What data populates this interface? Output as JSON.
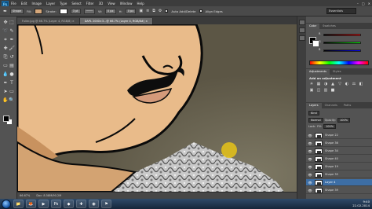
{
  "app": {
    "logo": "Ps"
  },
  "menu": [
    "File",
    "Edit",
    "Image",
    "Layer",
    "Type",
    "Select",
    "Filter",
    "3D",
    "View",
    "Window",
    "Help"
  ],
  "window_controls": [
    "–",
    "□",
    "✕"
  ],
  "options_bar": {
    "tool_mode": "Shape",
    "fill_label": "Fill:",
    "stroke_label": "Stroke:",
    "stroke_width": "3 pt",
    "w_label": "W:",
    "w_value": "0 px",
    "h_label": "H:",
    "h_value": "0 px",
    "auto_add_delete": "Auto Add/Delete",
    "align_edges": "Align Edges",
    "workspace": "Essentials",
    "fill_color": "#d6a77a",
    "stroke_color": "#ffffff"
  },
  "document_tabs": [
    {
      "label": "Fuller.jpg @ 66.7% (Layer 4, RGB/8) ×",
      "active": false
    },
    {
      "label": "DAPL 2000×3...@ 66.7% (Layer 4, RGB/8#) ×",
      "active": true
    }
  ],
  "tools": [
    {
      "name": "move-tool-icon",
      "glyph": "✥"
    },
    {
      "name": "marquee-tool-icon",
      "glyph": "⬚"
    },
    {
      "name": "lasso-tool-icon",
      "glyph": "➰"
    },
    {
      "name": "quick-select-tool-icon",
      "glyph": "✎"
    },
    {
      "name": "crop-tool-icon",
      "glyph": "⌗"
    },
    {
      "name": "eyedropper-tool-icon",
      "glyph": "✒"
    },
    {
      "name": "healing-brush-tool-icon",
      "glyph": "✚"
    },
    {
      "name": "brush-tool-icon",
      "glyph": "🖌"
    },
    {
      "name": "clone-stamp-tool-icon",
      "glyph": "⎘"
    },
    {
      "name": "history-brush-tool-icon",
      "glyph": "↺"
    },
    {
      "name": "eraser-tool-icon",
      "glyph": "▭"
    },
    {
      "name": "gradient-tool-icon",
      "glyph": "▤"
    },
    {
      "name": "blur-tool-icon",
      "glyph": "💧"
    },
    {
      "name": "dodge-tool-icon",
      "glyph": "●"
    },
    {
      "name": "pen-tool-icon",
      "glyph": "✒"
    },
    {
      "name": "type-tool-icon",
      "glyph": "T"
    },
    {
      "name": "path-select-tool-icon",
      "glyph": "➤"
    },
    {
      "name": "shape-tool-icon",
      "glyph": "▭"
    },
    {
      "name": "hand-tool-icon",
      "glyph": "✋"
    },
    {
      "name": "zoom-tool-icon",
      "glyph": "🔍"
    }
  ],
  "status_bar": {
    "zoom": "66.67%",
    "doc_info": "Doc: 8.58M/90.2M"
  },
  "color_panel": {
    "tabs": [
      "Color",
      "Swatches"
    ],
    "sliders": [
      {
        "label": "R",
        "gradient": "linear-gradient(90deg,#000,#f00)"
      },
      {
        "label": "G",
        "gradient": "linear-gradient(90deg,#000,#0f0)"
      },
      {
        "label": "B",
        "gradient": "linear-gradient(90deg,#000,#00f)"
      }
    ]
  },
  "adjustments_panel": {
    "tabs": [
      "Adjustments",
      "Styles"
    ],
    "title": "Add an adjustment",
    "icons": [
      "☀",
      "▦",
      "◑",
      "▲",
      "▽",
      "◐",
      "⚖",
      "◧",
      "▣",
      "◫",
      "▥",
      "■"
    ]
  },
  "layers_panel": {
    "tabs": [
      "Layers",
      "Channels",
      "Paths"
    ],
    "kind_filter": "Kind",
    "blend_mode": "Normal",
    "opacity_label": "Opacity:",
    "opacity_value": "100%",
    "lock_label": "Lock:",
    "fill_label": "Fill:",
    "fill_value": "100%",
    "layers": [
      {
        "name": "Shape 22",
        "selected": false
      },
      {
        "name": "Shape 36",
        "selected": false
      },
      {
        "name": "Shape 34",
        "selected": false
      },
      {
        "name": "Shape 40",
        "selected": false
      },
      {
        "name": "Shape 19",
        "selected": false
      },
      {
        "name": "Shape 35",
        "selected": false
      },
      {
        "name": "Layer 4",
        "selected": true
      },
      {
        "name": "Shape 39",
        "selected": false
      }
    ]
  },
  "taskbar": {
    "apps": [
      {
        "name": "explorer-icon",
        "glyph": "📁"
      },
      {
        "name": "firefox-icon",
        "glyph": "🦊"
      },
      {
        "name": "media-icon",
        "glyph": "▶"
      },
      {
        "name": "photoshop-icon",
        "glyph": "Ps"
      },
      {
        "name": "app5-icon",
        "glyph": "◆"
      },
      {
        "name": "app6-icon",
        "glyph": "✚"
      },
      {
        "name": "app7-icon",
        "glyph": "◉"
      },
      {
        "name": "app8-icon",
        "glyph": "⚑"
      }
    ],
    "time": "9:40",
    "date": "22.02.2014"
  }
}
